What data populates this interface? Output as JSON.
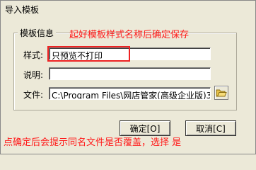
{
  "window": {
    "title": "导入模板"
  },
  "group": {
    "legend": "模板信息"
  },
  "annotations": {
    "top": "起好模板样式名称后确定保存",
    "bottom": "点确定后会提示同名文件是否覆盖，选择 是"
  },
  "fields": {
    "style_label": "样式:",
    "style_value": "只预览不打印",
    "desc_label": "说明:",
    "desc_value": "",
    "file_label": "文件:",
    "file_value": "C:\\Program Files\\网店管家(高级企业版)3."
  },
  "buttons": {
    "ok": "确定[O]",
    "cancel": "取消[C]"
  },
  "colors": {
    "annotation": "#ff1a1a",
    "folder_icon": "#e8c24a"
  }
}
